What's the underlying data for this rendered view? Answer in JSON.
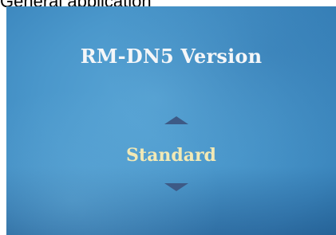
{
  "caption": "General application",
  "screen": {
    "title": "RM-DN5 Version",
    "selected_value": "Standard",
    "up_icon": "triangle-up-icon",
    "down_icon": "triangle-down-icon"
  }
}
